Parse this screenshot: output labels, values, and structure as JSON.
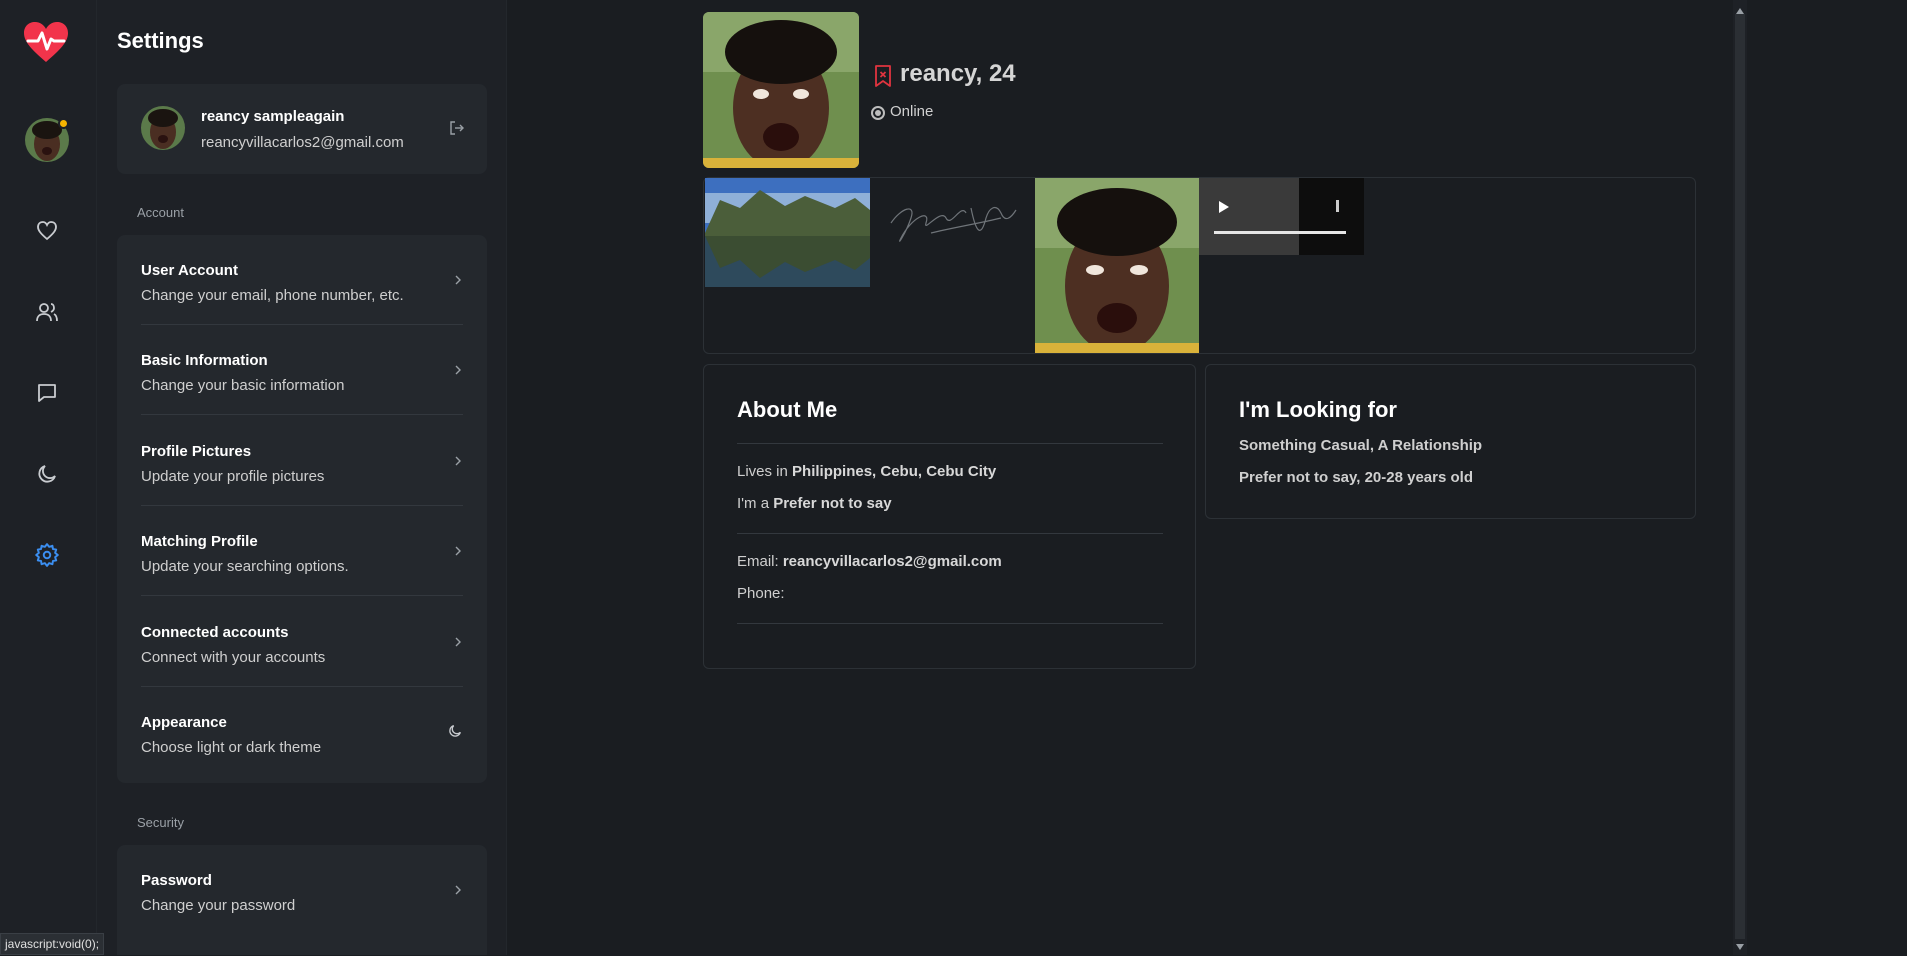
{
  "rail": {
    "icons": [
      "heart-pulse-logo",
      "profile-avatar",
      "heart-icon",
      "users-icon",
      "chat-icon",
      "moon-icon",
      "gear-icon"
    ],
    "accent": "#3b8ef0",
    "logo_color": "#f2344b",
    "presence_color": "#f5b400"
  },
  "settings": {
    "title": "Settings",
    "user": {
      "name": "reancy sampleagain",
      "email": "reancyvillacarlos2@gmail.com"
    },
    "account_label": "Account",
    "account_items": [
      {
        "title": "User Account",
        "subtitle": "Change your email, phone number, etc."
      },
      {
        "title": "Basic Information",
        "subtitle": "Change your basic information"
      },
      {
        "title": "Profile Pictures",
        "subtitle": "Update your profile pictures"
      },
      {
        "title": "Matching Profile",
        "subtitle": "Update your searching options."
      },
      {
        "title": "Connected accounts",
        "subtitle": "Connect with your accounts"
      },
      {
        "title": "Appearance",
        "subtitle": "Choose light or dark theme"
      }
    ],
    "security_label": "Security",
    "security_items": [
      {
        "title": "Password",
        "subtitle": "Change your password"
      }
    ]
  },
  "profile": {
    "name_age": "reancy, 24",
    "status": "Online",
    "about": {
      "title": "About Me",
      "lives_prefix": "Lives in ",
      "lives_value": "Philippines, Cebu, Cebu City",
      "gender_prefix": "I'm a ",
      "gender_value": "Prefer not to say",
      "email_prefix": "Email: ",
      "email_value": "reancyvillacarlos2@gmail.com",
      "phone_prefix": "Phone:",
      "phone_value": ""
    },
    "looking": {
      "title": "I'm Looking for",
      "line1": "Something Casual, A Relationship",
      "line2": "Prefer not to say, 20-28 years old"
    }
  },
  "statusbar": "javascript:void(0);"
}
